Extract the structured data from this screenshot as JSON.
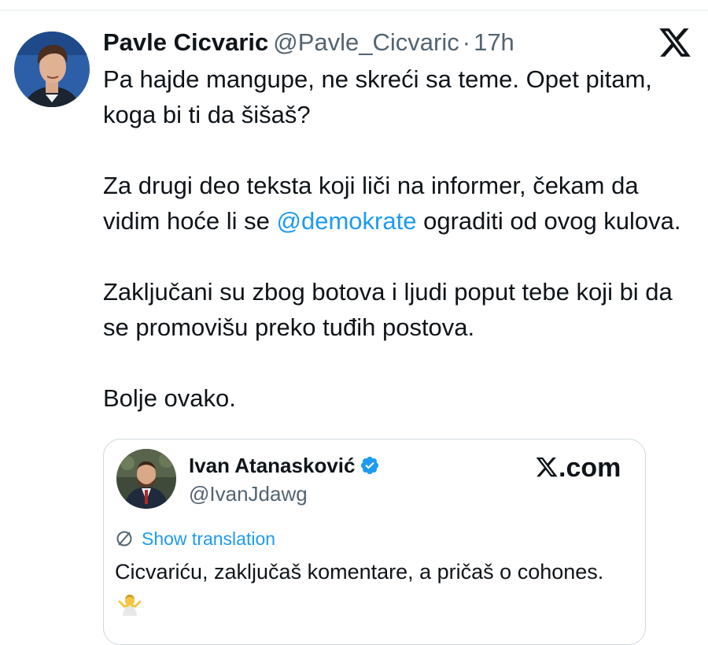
{
  "tweet": {
    "author_name": "Pavle Cicvaric",
    "author_handle": "@Pavle_Cicvaric",
    "separator": "·",
    "time": "17h",
    "paragraph1": "Pa hajde mangupe, ne skreći sa teme. Opet pitam, koga bi ti da šišaš?",
    "paragraph2_before": "Za drugi deo teksta koji liči na informer, čekam da vidim hoće li se ",
    "paragraph2_mention": "@demokrate",
    "paragraph2_after": " ograditi od ovog kulova.",
    "paragraph3": "Zaključani su zbog botova i ljudi poput tebe koji bi da se promovišu preko tuđih postova.",
    "paragraph4": "Bolje ovako.",
    "platform_icon": "x-logo-icon"
  },
  "quoted": {
    "author_name": "Ivan Atanasković",
    "author_handle": "@IvanJdawg",
    "verified_icon": "verified-badge-icon",
    "source_label": ".com",
    "translate_label": "Show translation",
    "text": "Cicvariću, zaključaš komentare, a pričaš o cohones.",
    "emoji_icon": "person-shrugging-icon"
  },
  "colors": {
    "link": "#1d9bf0",
    "text": "#0f1419",
    "secondary": "#536471",
    "border": "#cfd9de"
  }
}
